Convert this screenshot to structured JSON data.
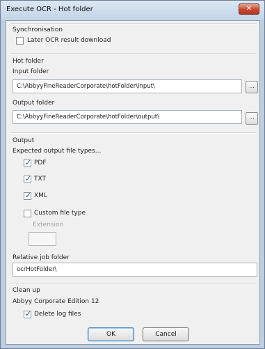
{
  "window": {
    "title": "Execute OCR - Hot folder",
    "close_label": "✕"
  },
  "synchronisation": {
    "heading": "Synchronisation",
    "later_download": {
      "label": "Later OCR result download",
      "checked": false
    }
  },
  "hot_folder": {
    "heading": "Hot folder",
    "input_label": "Input folder",
    "input_value": "C:\\AbbyyFineReaderCorporate\\hotFolder\\input\\",
    "output_label": "Output folder",
    "output_value": "C:\\AbbyyFineReaderCorporate\\hotFolder\\output\\",
    "browse_label": "..."
  },
  "output": {
    "heading": "Output",
    "types_label": "Expected output file types...",
    "pdf": {
      "label": "PDF",
      "checked": true
    },
    "txt": {
      "label": "TXT",
      "checked": true
    },
    "xml": {
      "label": "XML",
      "checked": true
    },
    "custom": {
      "label": "Custom file type",
      "checked": false
    },
    "extension_label": "Extension",
    "extension_value": ""
  },
  "relative_job": {
    "label": "Relative job folder",
    "value": "ocrHotFolder\\"
  },
  "clean_up": {
    "heading": "Clean up",
    "edition": "Abbyy Corporate Edition 12",
    "delete_logs": {
      "label": "Delete log files",
      "checked": true
    }
  },
  "buttons": {
    "ok": "OK",
    "cancel": "Cancel"
  },
  "tick_glyph": "✓",
  "colors": {
    "title_bar": "#c8d8ea",
    "close_button": "#c8462e",
    "panel": "#f0f0f0",
    "check_tick": "#2d4c78"
  }
}
